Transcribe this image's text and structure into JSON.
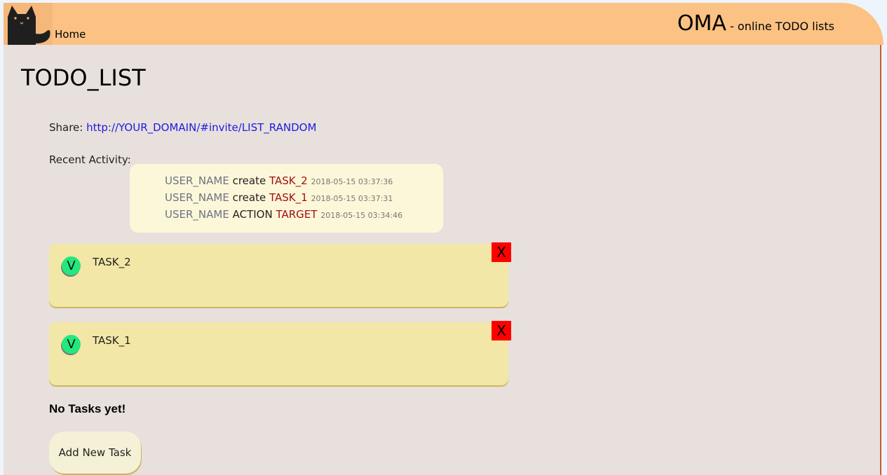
{
  "header": {
    "home_label": "Home",
    "brand_title": "OMA",
    "brand_subtitle": " - online TODO lists"
  },
  "page": {
    "title": "TODO_LIST"
  },
  "share": {
    "label": "Share: ",
    "url": "http://YOUR_DOMAIN/#invite/LIST_RANDOM"
  },
  "activity": {
    "label": "Recent Activity:",
    "entries": [
      {
        "user": "USER_NAME",
        "action": "create",
        "target": "TASK_2",
        "time": "2018-05-15 03:37:36"
      },
      {
        "user": "USER_NAME",
        "action": "create",
        "target": "TASK_1",
        "time": "2018-05-15 03:37:31"
      },
      {
        "user": "USER_NAME",
        "action": "ACTION",
        "target": "TARGET",
        "time": "2018-05-15 03:34:46"
      }
    ]
  },
  "tasks": [
    {
      "name": "TASK_2",
      "done_label": "V",
      "delete_label": "X"
    },
    {
      "name": "TASK_1",
      "done_label": "V",
      "delete_label": "X"
    }
  ],
  "empty_message": "No Tasks yet!",
  "add_task_label": "Add New Task",
  "colors": {
    "header_bg": "#fcc284",
    "content_bg": "#e8e0dc",
    "task_card_bg": "#f2e7a6",
    "activity_bg": "#fdf7d9",
    "check_btn": "#23e87e",
    "delete_btn": "#ff0000",
    "link": "#1b1be0",
    "target_text": "#a01010"
  },
  "icons": {
    "logo": "black-cat-icon",
    "check": "check-circle-icon",
    "delete": "close-icon"
  }
}
